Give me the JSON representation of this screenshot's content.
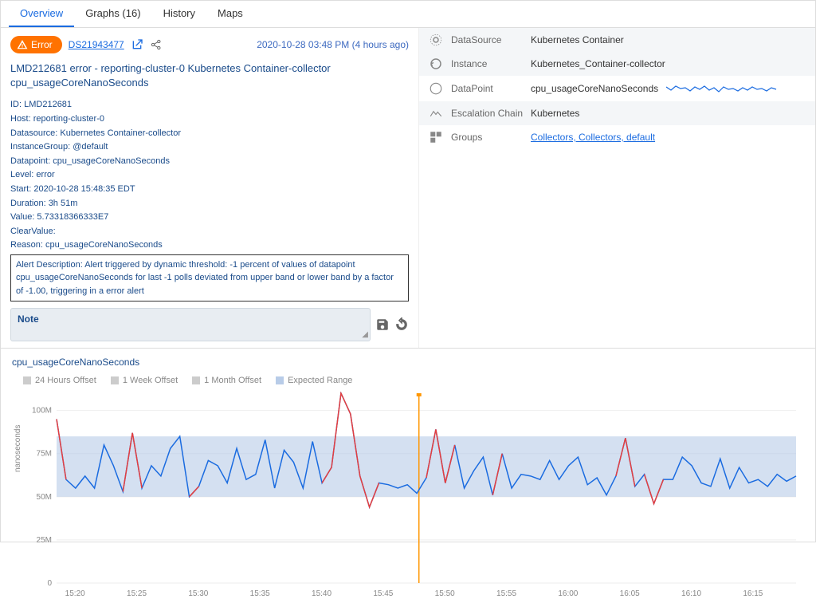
{
  "tabs": {
    "overview": "Overview",
    "graphs": "Graphs (16)",
    "history": "History",
    "maps": "Maps"
  },
  "alert": {
    "badge": "Error",
    "ds_id": "DS21943477",
    "timestamp": "2020-10-28 03:48 PM (4 hours ago)",
    "title": "LMD212681 error - reporting-cluster-0 Kubernetes Container-collector cpu_usageCoreNanoSeconds"
  },
  "details": {
    "id": "ID: LMD212681",
    "host": "Host: reporting-cluster-0",
    "datasource": "Datasource: Kubernetes Container-collector",
    "instance_group": "InstanceGroup: @default",
    "datapoint": "Datapoint: cpu_usageCoreNanoSeconds",
    "level": "Level: error",
    "start": "Start: 2020-10-28 15:48:35 EDT",
    "duration": "Duration: 3h 51m",
    "value": "Value: 5.73318366333E7",
    "clear_value": "ClearValue:",
    "reason": "Reason: cpu_usageCoreNanoSeconds",
    "description": "Alert Description: Alert triggered by dynamic threshold: -1 percent of values of datapoint cpu_usageCoreNanoSeconds for last -1 polls deviated from upper band or lower band by a factor of -1.00, triggering in a error alert"
  },
  "note": {
    "label": "Note",
    "value": ""
  },
  "right": {
    "datasource": {
      "label": "DataSource",
      "value": "Kubernetes Container"
    },
    "instance": {
      "label": "Instance",
      "value": "Kubernetes_Container-collector"
    },
    "datapoint": {
      "label": "DataPoint",
      "value": "cpu_usageCoreNanoSeconds"
    },
    "escalation": {
      "label": "Escalation Chain",
      "value": "Kubernetes"
    },
    "groups": {
      "label": "Groups",
      "value": "Collectors, Collectors, default"
    }
  },
  "chart_data": {
    "type": "line",
    "title": "cpu_usageCoreNanoSeconds",
    "ylabel": "nanoseconds",
    "ylim": [
      0,
      110
    ],
    "yticks": [
      0,
      25,
      50,
      75,
      100
    ],
    "ytick_labels": [
      "0",
      "25M",
      "50M",
      "75M",
      "100M"
    ],
    "x_range": [
      "15:18",
      "16:19"
    ],
    "xticks": [
      "15:20",
      "15:25",
      "15:30",
      "15:35",
      "15:40",
      "15:45",
      "15:50",
      "15:55",
      "16:00",
      "16:05",
      "16:10",
      "16:15"
    ],
    "expected_band": {
      "lower": 50,
      "upper": 85
    },
    "marker_time": "15:49",
    "legend": [
      "24 Hours Offset",
      "1 Week Offset",
      "1 Month Offset",
      "Expected Range"
    ],
    "values": [
      95,
      60,
      55,
      62,
      55,
      80,
      68,
      53,
      87,
      55,
      68,
      62,
      78,
      85,
      50,
      56,
      71,
      68,
      58,
      78,
      60,
      63,
      83,
      55,
      77,
      70,
      55,
      82,
      58,
      67,
      110,
      98,
      62,
      44,
      58,
      57,
      55,
      57,
      52,
      61,
      89,
      58,
      80,
      55,
      65,
      73,
      51,
      75,
      55,
      63,
      62,
      60,
      71,
      60,
      68,
      73,
      57,
      61,
      51,
      62,
      84,
      56,
      63,
      46,
      60,
      60,
      73,
      68,
      58,
      56,
      72,
      55,
      67,
      58,
      60,
      56,
      63,
      59,
      62
    ],
    "anomaly_segments": [
      {
        "start_idx": 0,
        "end_idx": 1
      },
      {
        "start_idx": 7,
        "end_idx": 9
      },
      {
        "start_idx": 14,
        "end_idx": 15
      },
      {
        "start_idx": 28,
        "end_idx": 34
      },
      {
        "start_idx": 39,
        "end_idx": 42
      },
      {
        "start_idx": 46,
        "end_idx": 47
      },
      {
        "start_idx": 59,
        "end_idx": 61
      },
      {
        "start_idx": 62,
        "end_idx": 64
      }
    ]
  }
}
